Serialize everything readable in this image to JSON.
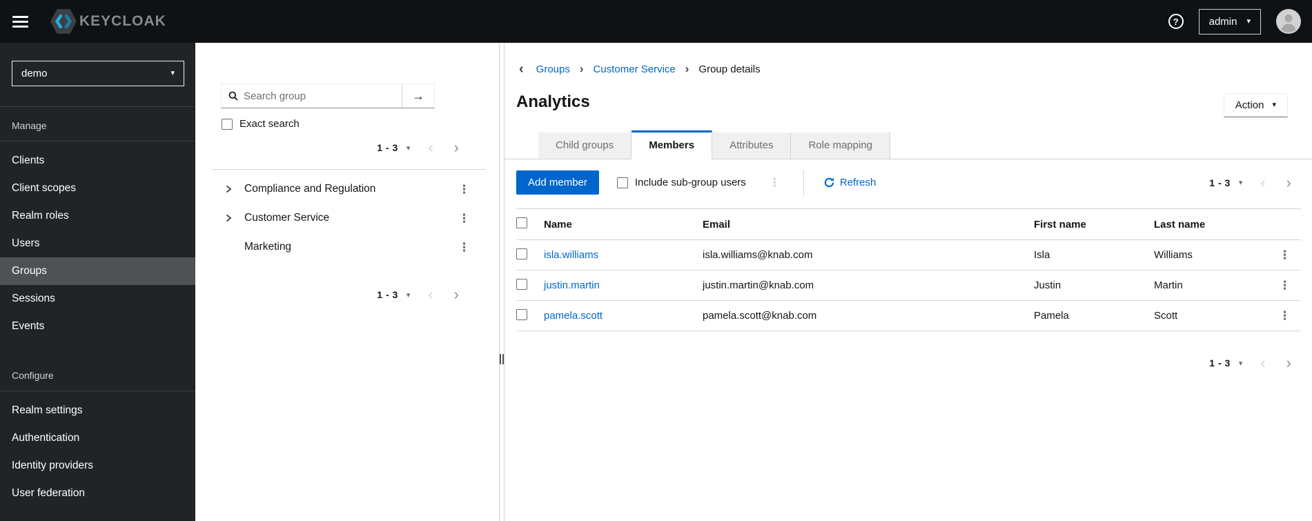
{
  "masthead": {
    "brand": "KEYCLOAK",
    "help_icon_glyph": "?",
    "user": "admin"
  },
  "icons": {
    "caret_down": "▾",
    "kebab": "⋮",
    "breadcrumb_sep": "›",
    "back": "‹",
    "prev": "‹",
    "next": "›",
    "arrow_right": "→"
  },
  "sidebar": {
    "realm": "demo",
    "sections": [
      {
        "label": "Manage",
        "items": [
          "Clients",
          "Client scopes",
          "Realm roles",
          "Users",
          "Groups",
          "Sessions",
          "Events"
        ]
      },
      {
        "label": "Configure",
        "items": [
          "Realm settings",
          "Authentication",
          "Identity providers",
          "User federation"
        ]
      }
    ],
    "selected_item": "Groups"
  },
  "tree": {
    "search_placeholder": "Search group",
    "search_value": "",
    "exact_search_label": "Exact search",
    "pagination_label": "1 - 3",
    "items": [
      {
        "label": "Compliance and Regulation",
        "expandable": true
      },
      {
        "label": "Customer Service",
        "expandable": true
      },
      {
        "label": "Marketing",
        "expandable": false
      }
    ]
  },
  "main": {
    "breadcrumb": [
      "Groups",
      "Customer Service",
      "Group details"
    ],
    "title": "Analytics",
    "action_label": "Action",
    "tabs": [
      "Child groups",
      "Members",
      "Attributes",
      "Role mapping"
    ],
    "active_tab": "Members",
    "toolbar": {
      "add_member_label": "Add member",
      "include_subgroups_label": "Include sub-group users",
      "refresh_label": "Refresh",
      "pagination_label": "1 - 3"
    },
    "table": {
      "headers": [
        "Name",
        "Email",
        "First name",
        "Last name"
      ],
      "rows": [
        {
          "name": "isla.williams",
          "email": "isla.williams@knab.com",
          "first": "Isla",
          "last": "Williams"
        },
        {
          "name": "justin.martin",
          "email": "justin.martin@knab.com",
          "first": "Justin",
          "last": "Martin"
        },
        {
          "name": "pamela.scott",
          "email": "pamela.scott@knab.com",
          "first": "Pamela",
          "last": "Scott"
        }
      ]
    },
    "footer_pagination_label": "1 - 3"
  },
  "colors": {
    "accent": "#0066cc",
    "link": "#0066cc",
    "masthead_bg": "#0f1214",
    "sidebar_bg": "#212427",
    "sidebar_selected_bg": "#4f5255",
    "tab_inactive_bg": "#f0f0f0",
    "border": "#d2d2d2"
  }
}
